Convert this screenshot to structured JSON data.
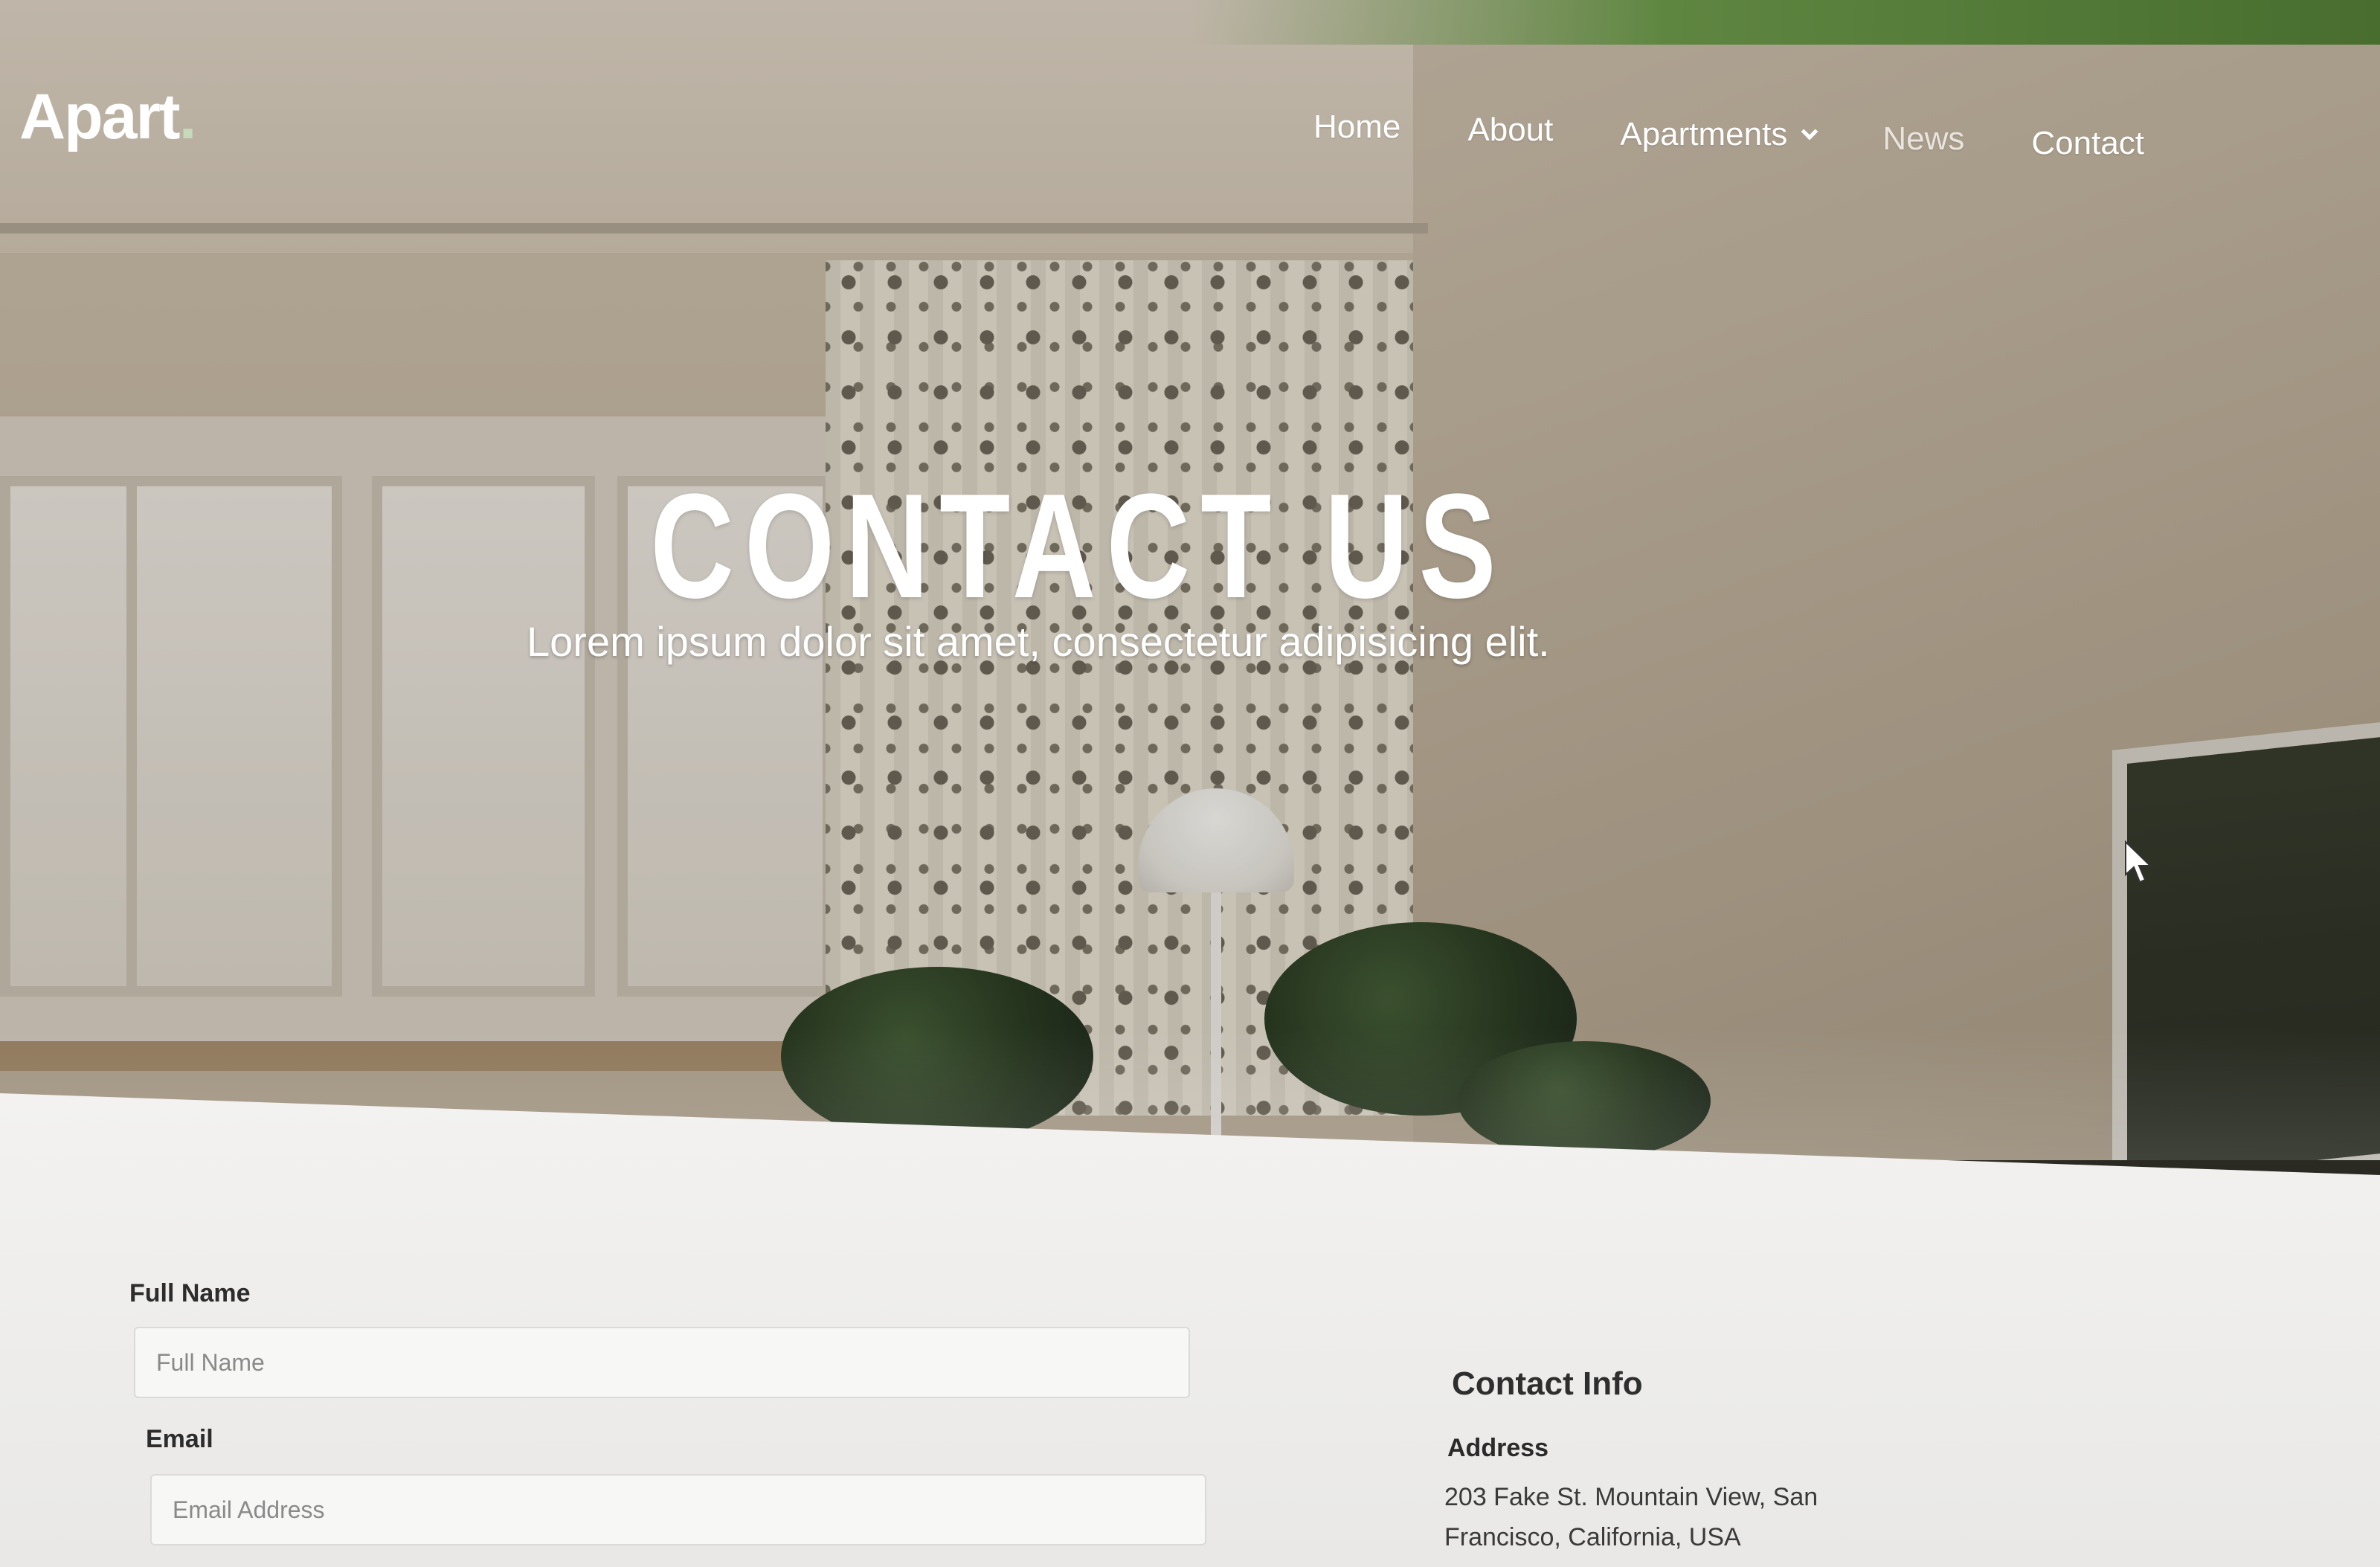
{
  "brand": {
    "logo_text": "Apart",
    "logo_dot": "."
  },
  "nav": {
    "items": [
      {
        "label": "Home"
      },
      {
        "label": "About"
      },
      {
        "label": "Apartments",
        "has_dropdown": true
      },
      {
        "label": "News"
      },
      {
        "label": "Contact",
        "active": true
      }
    ]
  },
  "hero": {
    "title": "CONTACT US",
    "subtitle": "Lorem ipsum dolor sit amet, consectetur adipisicing elit."
  },
  "form": {
    "full_name": {
      "label": "Full Name",
      "placeholder": "Full Name"
    },
    "email": {
      "label": "Email",
      "placeholder": "Email Address"
    }
  },
  "contact_info": {
    "title": "Contact Info",
    "address_label": "Address",
    "address_value": "203 Fake St. Mountain View, San Francisco, California, USA"
  },
  "colors": {
    "accent_green": "#6a9a4a",
    "nav_text": "#ffffff",
    "content_bg": "#f3f2f0"
  }
}
